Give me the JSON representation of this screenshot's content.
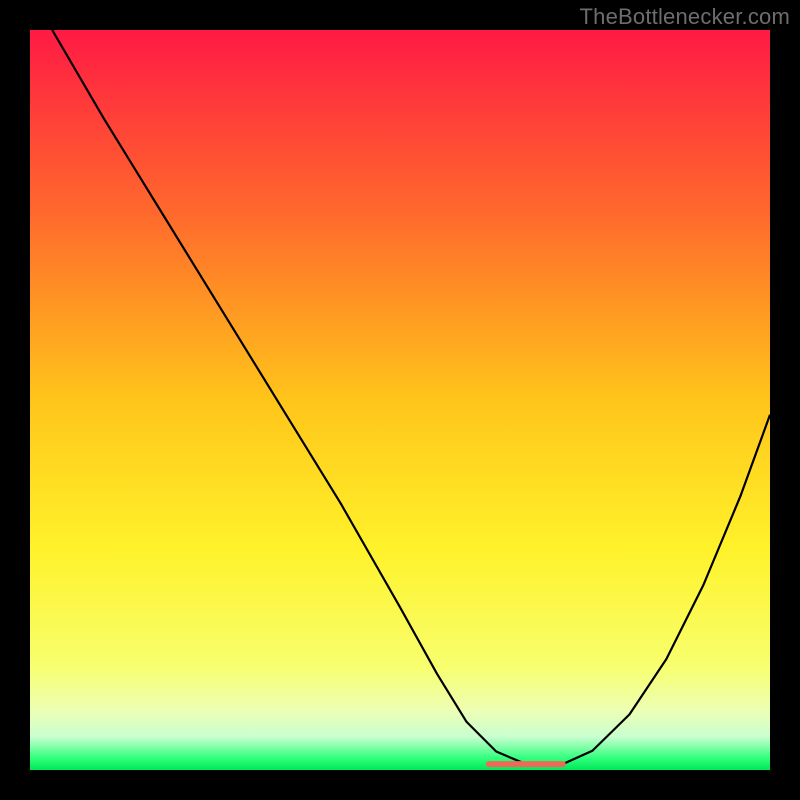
{
  "watermark": "TheBottlenecker.com",
  "chart_data": {
    "type": "line",
    "title": "",
    "xlabel": "",
    "ylabel": "",
    "xlim": [
      0,
      100
    ],
    "ylim": [
      0,
      100
    ],
    "grid": false,
    "background_gradient": {
      "stops": [
        {
          "offset": 0.0,
          "color": "#ff1a44"
        },
        {
          "offset": 0.25,
          "color": "#ff6a2c"
        },
        {
          "offset": 0.5,
          "color": "#ffc51a"
        },
        {
          "offset": 0.7,
          "color": "#fff22a"
        },
        {
          "offset": 0.86,
          "color": "#f8ff6e"
        },
        {
          "offset": 0.92,
          "color": "#ecffb4"
        },
        {
          "offset": 0.955,
          "color": "#c9ffd0"
        },
        {
          "offset": 0.985,
          "color": "#2cff7a"
        },
        {
          "offset": 1.0,
          "color": "#00e858"
        }
      ]
    },
    "series": [
      {
        "name": "bottleneck-curve",
        "color": "#000000",
        "width": 2.2,
        "x": [
          3,
          10,
          18,
          26,
          34,
          42,
          50,
          55,
          59,
          63,
          67,
          72,
          76,
          81,
          86,
          91,
          96,
          100
        ],
        "y": [
          100,
          88,
          75,
          62,
          49,
          36,
          22,
          13,
          6.5,
          2.5,
          0.8,
          0.8,
          2.6,
          7.5,
          15,
          25,
          37,
          48
        ]
      },
      {
        "name": "bottom-marker",
        "color": "#ed6a5a",
        "width": 6,
        "cap": "round",
        "x": [
          62,
          72
        ],
        "y": [
          0.8,
          0.8
        ]
      }
    ]
  }
}
